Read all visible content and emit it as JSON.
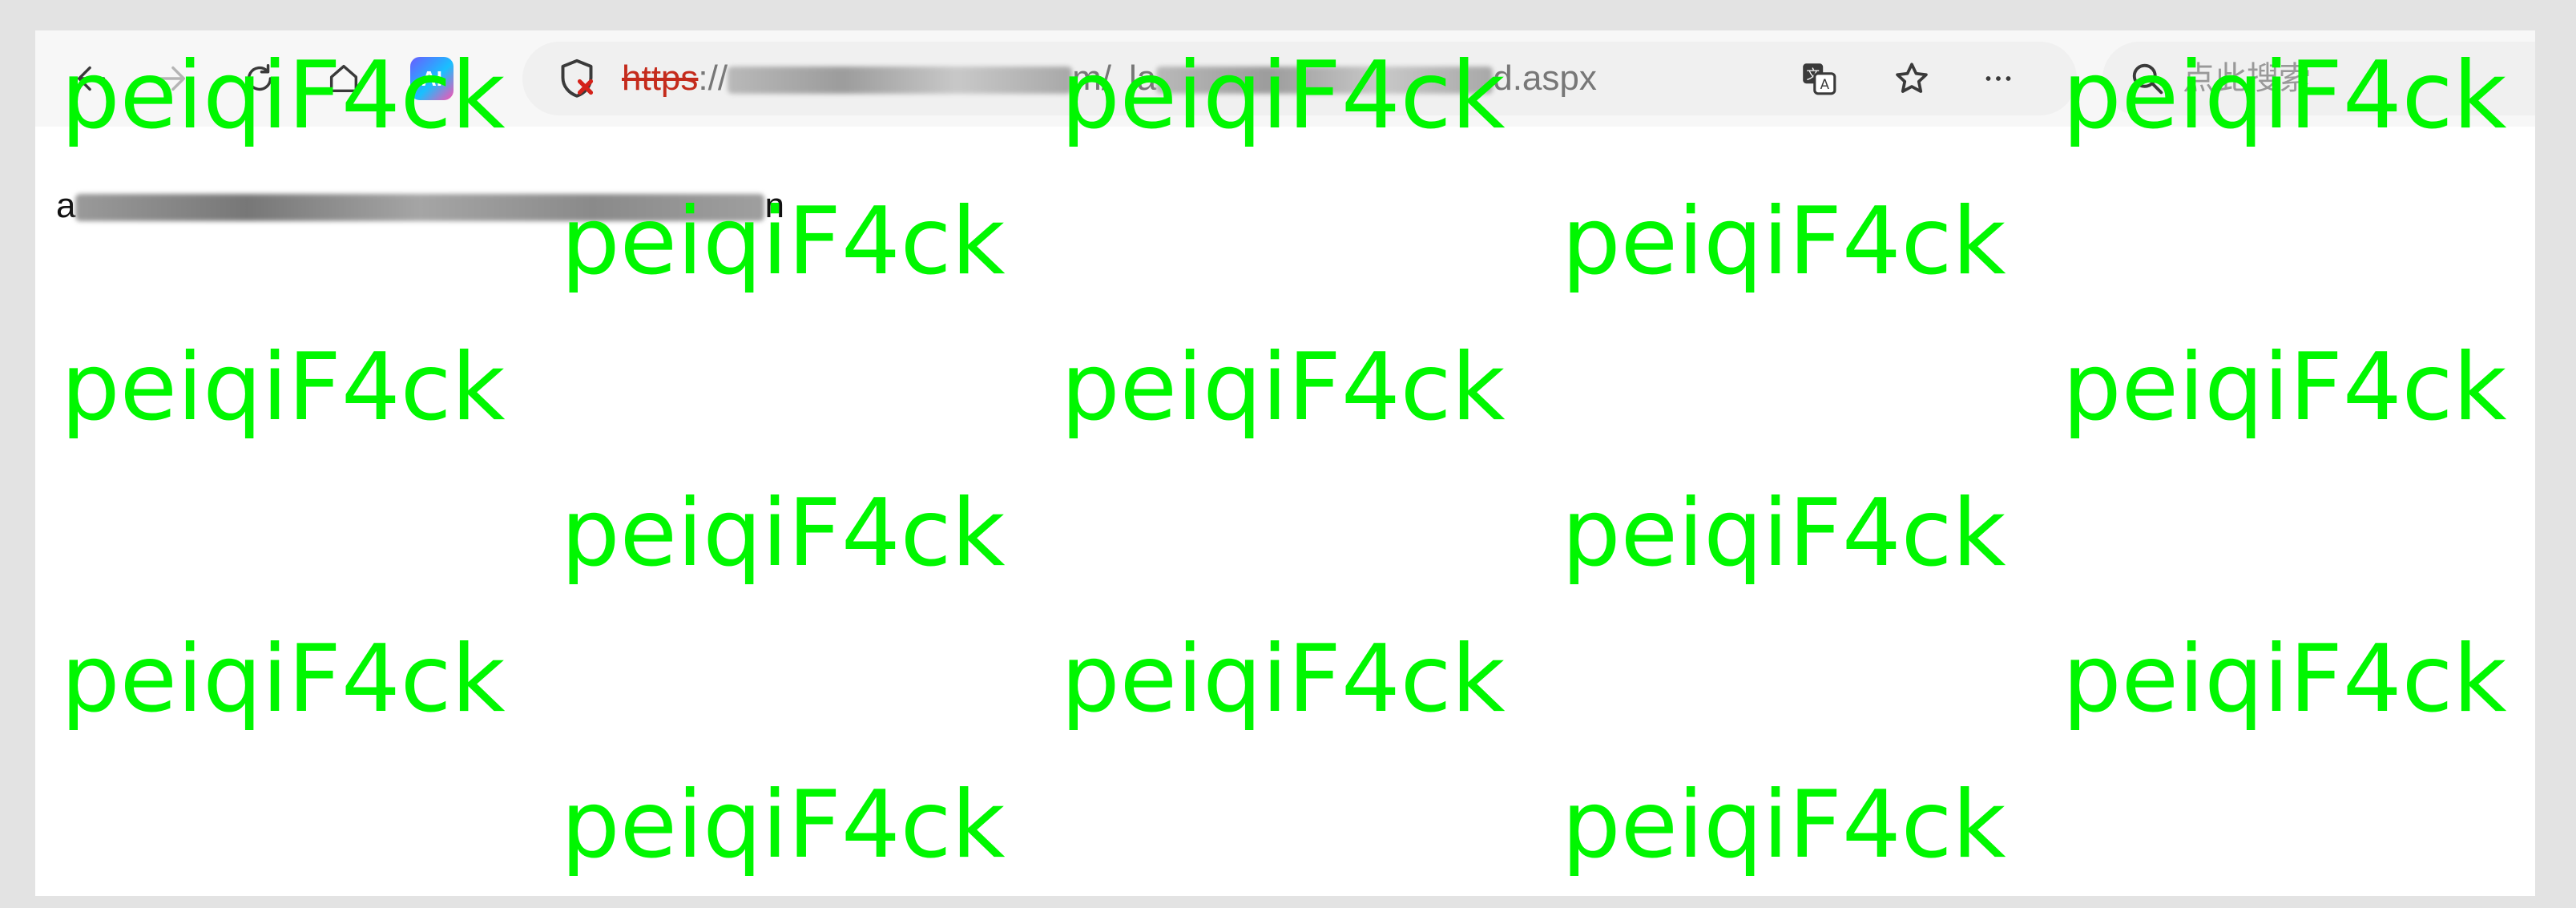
{
  "browser": {
    "toolbar": {
      "back_icon": "back-arrow-icon",
      "forward_icon": "forward-arrow-icon",
      "refresh_icon": "refresh-icon",
      "home_icon": "home-icon",
      "ai_button_label": "AI"
    },
    "address_bar": {
      "scheme": "https",
      "after_scheme": "://",
      "host_visible_end": "m/",
      "path_visible_start": "la",
      "path_visible_end": "d.aspx",
      "security_icon": "not-secure-shield-icon",
      "translate_icon": "translate-icon",
      "favorite_icon": "star-icon",
      "more_icon": "more-icon"
    },
    "search": {
      "placeholder": "点此搜索",
      "icon": "search-icon"
    }
  },
  "page": {
    "message_prefix": "a",
    "message_suffix": "n"
  },
  "watermark": {
    "text": "peiqiF4ck",
    "color": "#00f700"
  },
  "colors": {
    "insecure_scheme": "#c42b1c",
    "page_background": "#ffffff",
    "toolbar_background": "#f7f7f7"
  }
}
